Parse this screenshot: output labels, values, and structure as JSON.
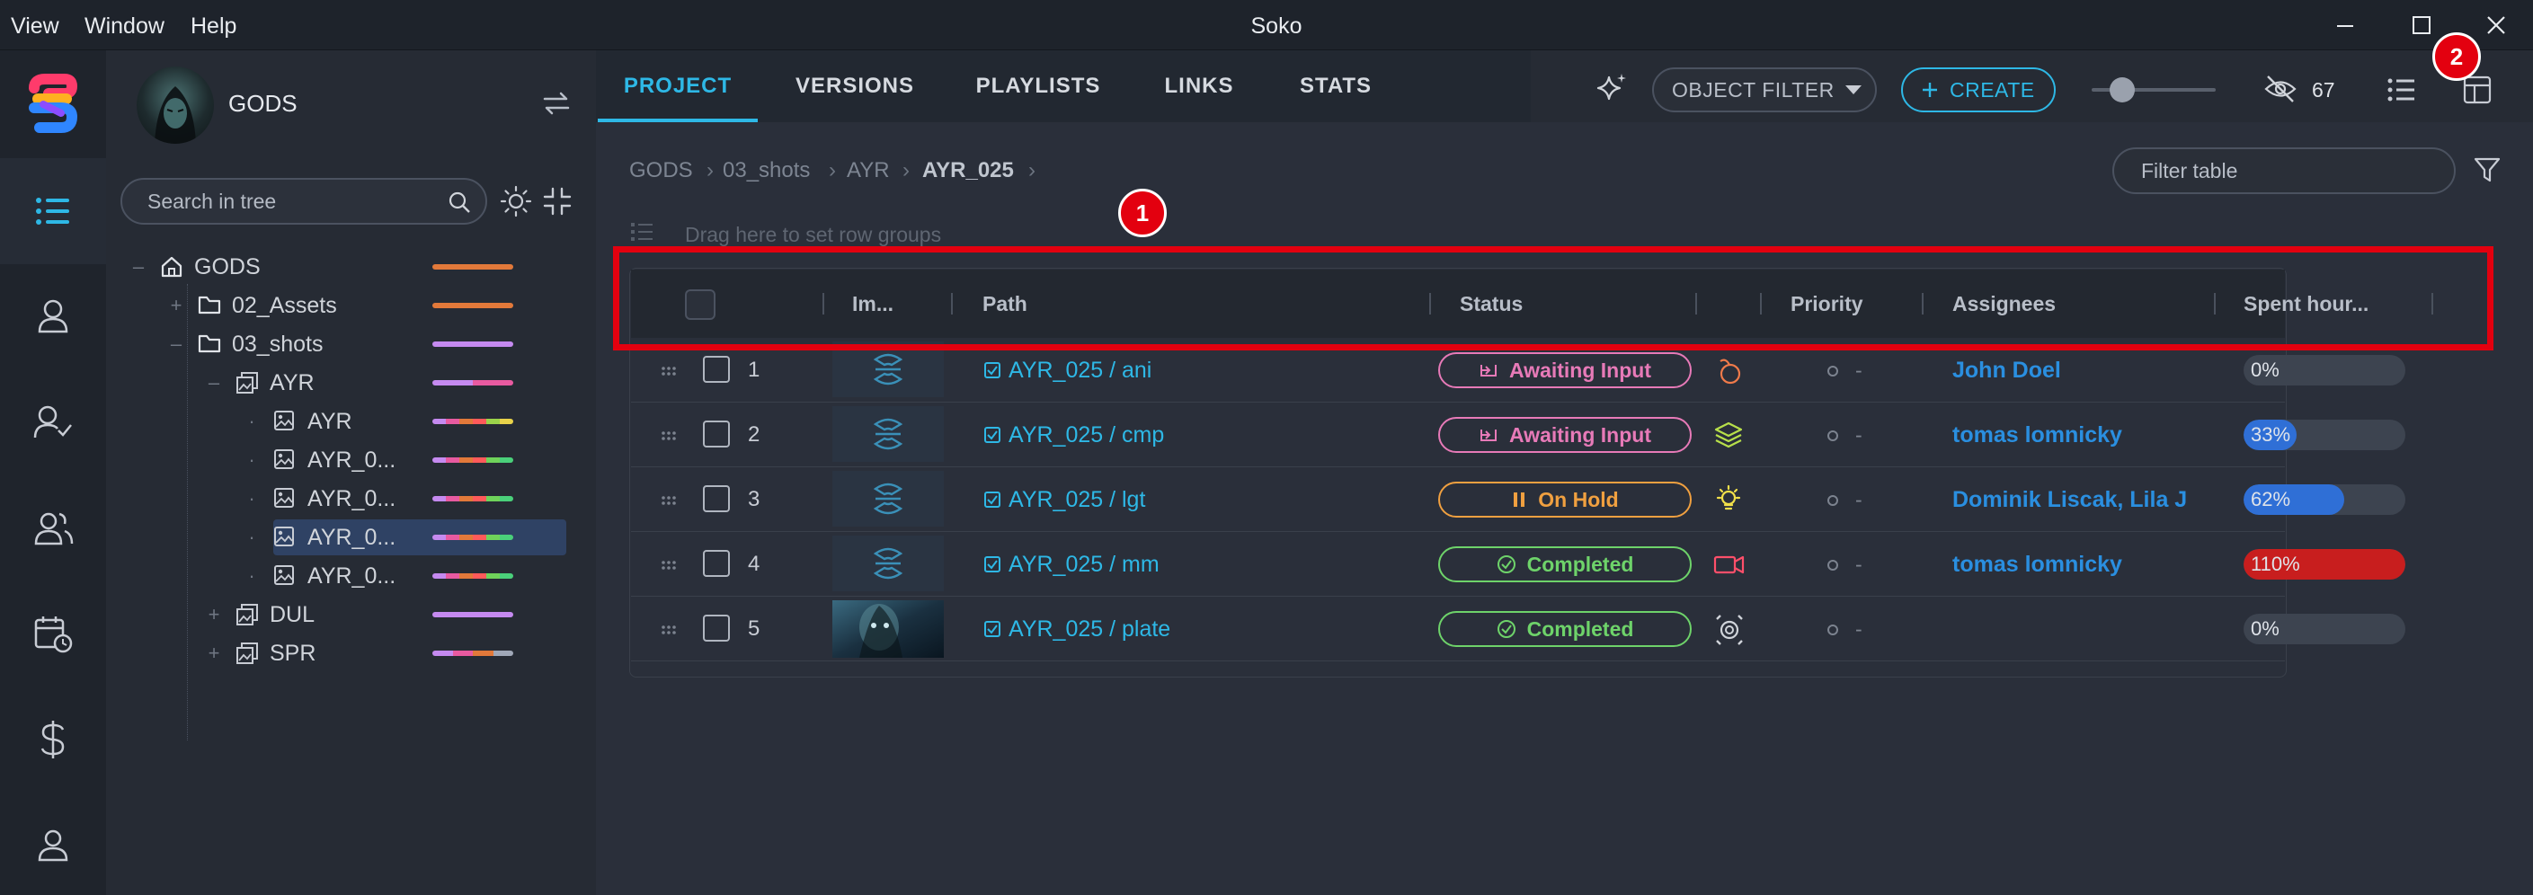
{
  "menu": {
    "view": "View",
    "window": "Window",
    "help": "Help"
  },
  "app_title": "Soko",
  "project": {
    "name": "GODS"
  },
  "tree_search": {
    "placeholder": "Search in tree"
  },
  "tree": [
    {
      "label": "GODS",
      "colors": [
        "#e2793a"
      ]
    },
    {
      "label": "02_Assets",
      "colors": [
        "#e2793a"
      ]
    },
    {
      "label": "03_shots",
      "colors": [
        "#c58af0"
      ]
    },
    {
      "label": "AYR",
      "colors": [
        "#c58af0",
        "#e85aa0"
      ]
    },
    {
      "label": "AYR",
      "colors": [
        "#c58af0",
        "#e85aa0",
        "#e2793a",
        "#ff5a5a",
        "#9bd34a",
        "#e8d24a"
      ]
    },
    {
      "label": "AYR_0...",
      "colors": [
        "#c58af0",
        "#e85aa0",
        "#e2793a",
        "#ff5a5a",
        "#6fd35a",
        "#4ad07a"
      ]
    },
    {
      "label": "AYR_0...",
      "colors": [
        "#c58af0",
        "#e85aa0",
        "#e2793a",
        "#ff5a5a",
        "#6fd35a",
        "#4ad07a"
      ]
    },
    {
      "label": "AYR_0...",
      "colors": [
        "#c58af0",
        "#e85aa0",
        "#e2793a",
        "#ff5a5a",
        "#6fd35a",
        "#4ad07a"
      ]
    },
    {
      "label": "AYR_0...",
      "colors": [
        "#c58af0",
        "#e85aa0",
        "#e2793a",
        "#ff5a5a",
        "#6fd35a",
        "#4ad07a"
      ]
    },
    {
      "label": "DUL",
      "colors": [
        "#c58af0"
      ]
    },
    {
      "label": "SPR",
      "colors": [
        "#c58af0",
        "#e85aa0",
        "#e2793a",
        "#a0a8b8"
      ]
    }
  ],
  "tabs": [
    "PROJECT",
    "VERSIONS",
    "PLAYLISTS",
    "LINKS",
    "STATS"
  ],
  "toolbar": {
    "object_filter": "OBJECT FILTER",
    "create": "CREATE",
    "hidden_count": "67"
  },
  "breadcrumb": [
    "GODS",
    "03_shots",
    "AYR",
    "AYR_025"
  ],
  "filter_table": {
    "placeholder": "Filter table"
  },
  "row_groups_hint": "Drag here to set row groups",
  "columns": {
    "image": "Im...",
    "path": "Path",
    "status": "Status",
    "priority": "Priority",
    "assignees": "Assignees",
    "spent": "Spent hour..."
  },
  "rows": [
    {
      "num": "1",
      "path": "AYR_025 / ani",
      "status": "Awaiting Input",
      "status_color": "#e77ab8",
      "priority": "-",
      "assignees": "John Doel",
      "spent": "0%",
      "spent_fraction": 0.0,
      "bar_color": "#2f6fd6",
      "thumb": "logo"
    },
    {
      "num": "2",
      "path": "AYR_025 / cmp",
      "status": "Awaiting Input",
      "status_color": "#e77ab8",
      "priority": "-",
      "assignees": "tomas lomnicky",
      "spent": "33%",
      "spent_fraction": 0.33,
      "bar_color": "#2f6fd6",
      "thumb": "logo"
    },
    {
      "num": "3",
      "path": "AYR_025 / lgt",
      "status": "On Hold",
      "status_color": "#f0a040",
      "priority": "-",
      "assignees": "Dominik Liscak, Lila J",
      "spent": "62%",
      "spent_fraction": 0.62,
      "bar_color": "#2f6fd6",
      "thumb": "logo"
    },
    {
      "num": "4",
      "path": "AYR_025 / mm",
      "status": "Completed",
      "status_color": "#6ed36a",
      "priority": "-",
      "assignees": "tomas lomnicky",
      "spent": "110%",
      "spent_fraction": 1.0,
      "bar_color": "#c81e1e",
      "thumb": "logo"
    },
    {
      "num": "5",
      "path": "AYR_025 / plate",
      "status": "Completed",
      "status_color": "#6ed36a",
      "priority": "-",
      "assignees": "",
      "spent": "0%",
      "spent_fraction": 0.0,
      "bar_color": "#2f6fd6",
      "thumb": "photo"
    }
  ],
  "annotations": [
    "1",
    "2"
  ],
  "colors": {
    "accent": "#2eb8e6",
    "link": "#2a8fe0",
    "highlight_box": "#e3000f"
  }
}
